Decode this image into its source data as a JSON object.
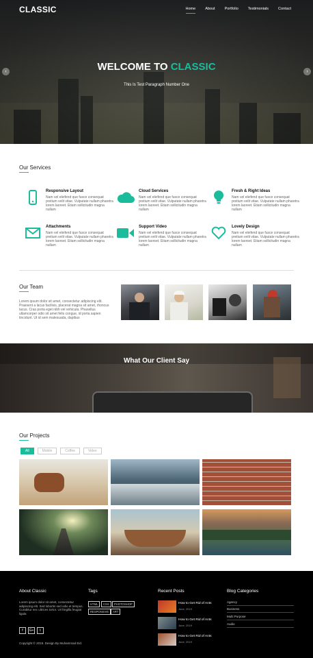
{
  "brand": "CLASSIC",
  "nav": [
    "Home",
    "About",
    "Portfolio",
    "Testimonials",
    "Contact"
  ],
  "hero": {
    "title_a": "WELCOME TO",
    "title_b": "CLASSIC",
    "subtitle": "This Is Test Paragraph Number One"
  },
  "services": {
    "title": "Our Services",
    "items": [
      {
        "title": "Responsive Layout",
        "icon": "mobile-icon",
        "text": "Nam vel eleifend que fusce consequat pretium velit vitae. Vulputate nullam pharetra lorem laoreet. Etiam sollicitudin magna nullam"
      },
      {
        "title": "Cloud Services",
        "icon": "cloud-icon",
        "text": "Nam vel eleifend que fusce consequat pretium velit vitae. Vulputate nullam pharetra lorem laoreet. Etiam sollicitudin magna nullam"
      },
      {
        "title": "Fresh & Right Ideas",
        "icon": "lightbulb-icon",
        "text": "Nam vel eleifend que fusce consequat pretium velit vitae. Vulputate nullam pharetra lorem laoreet. Etiam sollicitudin magna nullam"
      },
      {
        "title": "Attachments",
        "icon": "envelope-icon",
        "text": "Nam vel eleifend que fusce consequat pretium velit vitae. Vulputate nullam pharetra lorem laoreet. Etiam sollicitudin magna nullam"
      },
      {
        "title": "Support Video",
        "icon": "video-camera-icon",
        "text": "Nam vel eleifend que fusce consequat pretium velit vitae. Vulputate nullam pharetra lorem laoreet. Etiam sollicitudin magna nullam"
      },
      {
        "title": "Lovely Design",
        "icon": "heart-icon",
        "text": "Nam vel eleifend que fusce consequat pretium velit vitae. Vulputate nullam pharetra lorem laoreet. Etiam sollicitudin magna nullam"
      }
    ]
  },
  "team": {
    "title": "Our Team",
    "text": "Lorem ipsum dolor sit amet, consectetur adipiscing elit. Praesent a lacus facilisis, placerat magna sit amet, rhoncus lacus. Cras porta eget nibh vel vehicula. Phasellus ullamcorper odio sit amet felis congue, id porta sapien tincidunt. Ut id sem malesuada, dapibus"
  },
  "client": {
    "title": "What Our Client Say"
  },
  "projects": {
    "title": "Our Projects",
    "filters": [
      "All",
      "Mobile",
      "Coffee",
      "Video"
    ]
  },
  "footer": {
    "about_title": "About Classic",
    "about_text": "Lorem ipsum dolor sit amet, consectetur adipiscing elit. Sed lobortis sed odio et tempus. Curabitur nec ultrices tortor. Ut fringilla feugiat ligula",
    "tags_title": "Tags",
    "tags": [
      "HTML",
      "CSS",
      "PHOTOSHOP",
      "RESPONSIVE",
      "ART"
    ],
    "posts_title": "Recent Posts",
    "posts": [
      {
        "title": "How to Get Rid of Ants",
        "date": "June, 2019"
      },
      {
        "title": "How to Get Rid of Ants",
        "date": "June, 2019"
      },
      {
        "title": "How to Get Rid of Ants",
        "date": "June, 2019"
      }
    ],
    "cats_title": "Blog Categories",
    "cats": [
      "Agency",
      "Business",
      "Multi Purpose",
      "Audio"
    ],
    "social": [
      "f",
      "G+",
      "t"
    ],
    "copyright": "Copyright © 2019. Design By Muhammad Eid."
  },
  "colors": {
    "accent": "#1abc9c",
    "footer_bg": "#000000"
  }
}
